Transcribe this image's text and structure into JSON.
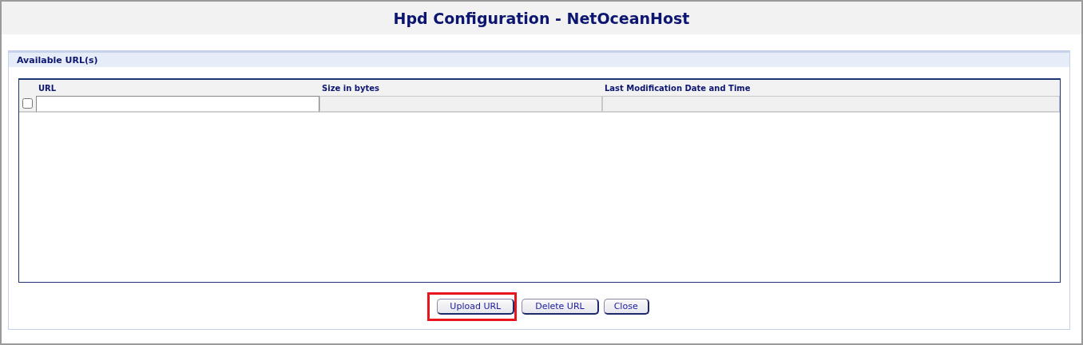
{
  "window": {
    "title": "Hpd Configuration - NetOceanHost"
  },
  "section": {
    "title": "Available URL(s)"
  },
  "table": {
    "columns": [
      "URL",
      "Size in bytes",
      "Last Modification Date and Time"
    ],
    "rows": [
      {
        "checked": false
      }
    ]
  },
  "buttons": [
    {
      "label": "Upload URL",
      "highlighted": true
    },
    {
      "label": "Delete URL",
      "highlighted": false
    },
    {
      "label": "Close",
      "highlighted": false
    }
  ]
}
